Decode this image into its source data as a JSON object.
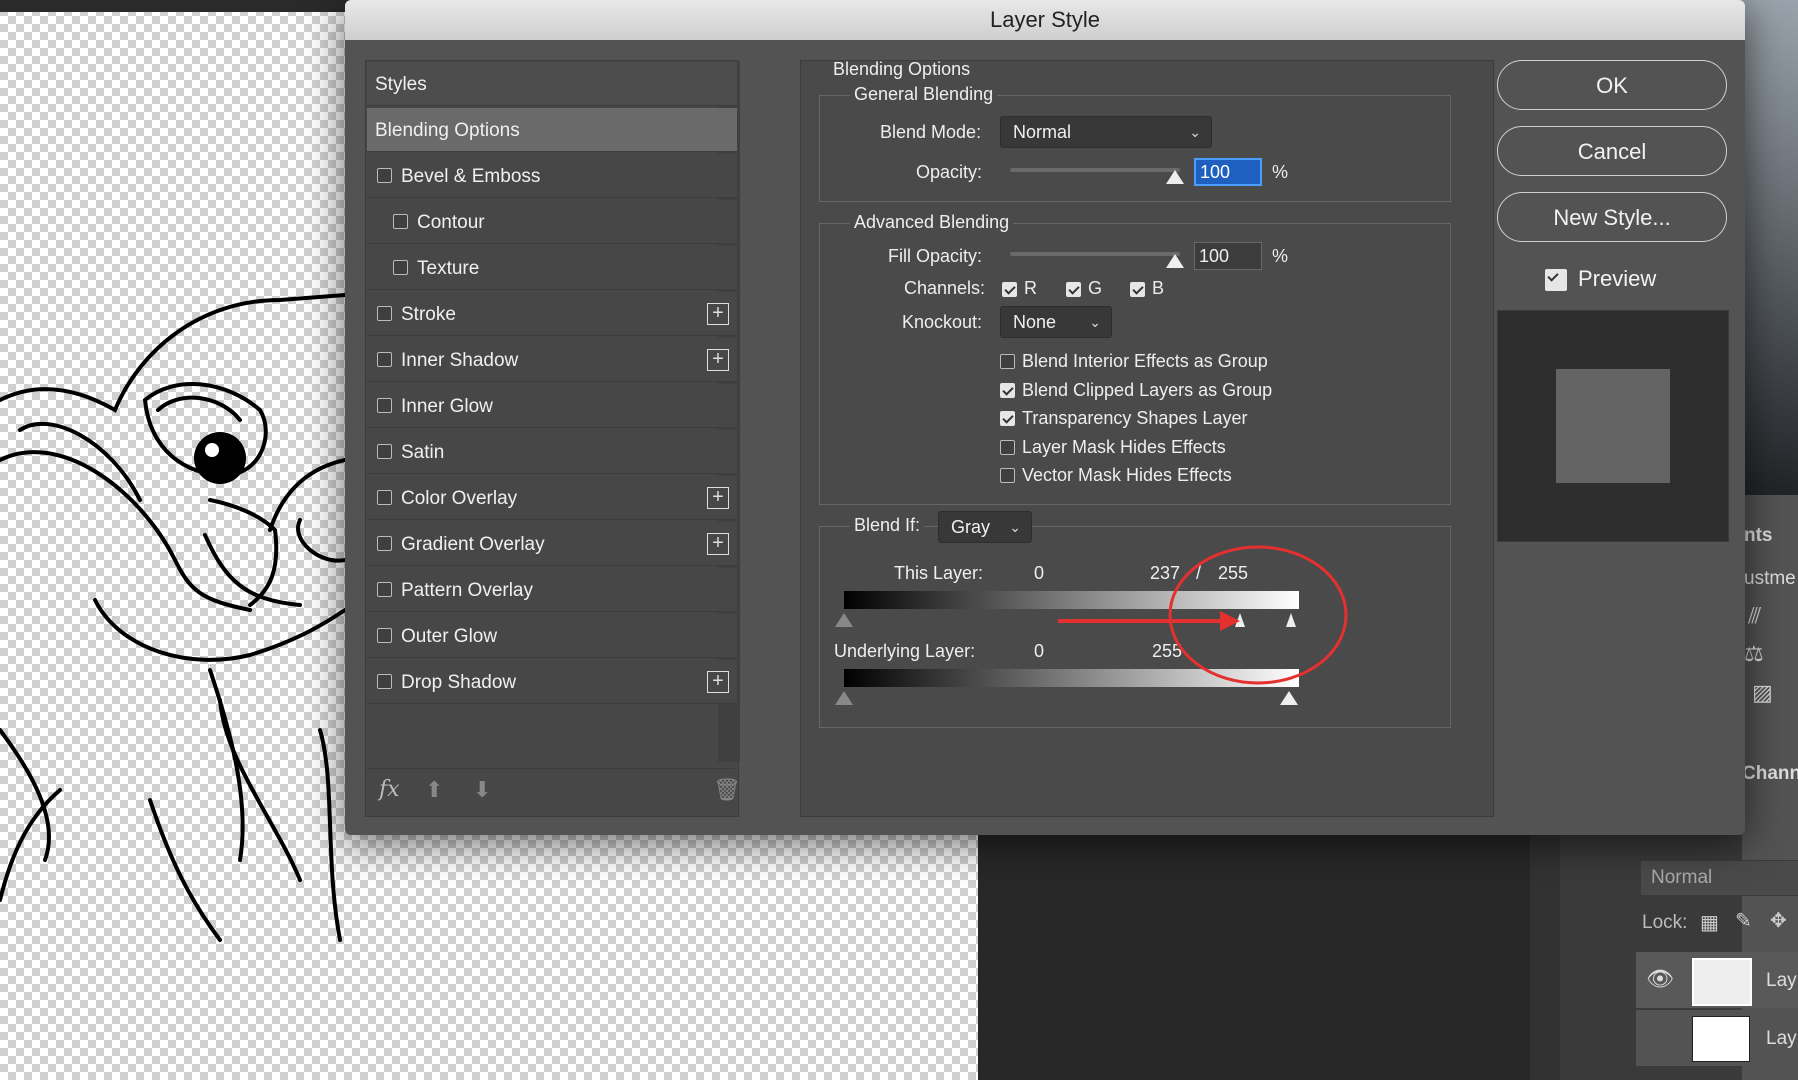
{
  "dialog": {
    "title": "Layer Style"
  },
  "styles": {
    "header": "Styles",
    "items": [
      {
        "label": "Blending Options",
        "checked": null,
        "plus": false
      },
      {
        "label": "Bevel & Emboss",
        "checked": false,
        "plus": false
      },
      {
        "label": "Contour",
        "checked": false,
        "plus": false
      },
      {
        "label": "Texture",
        "checked": false,
        "plus": false
      },
      {
        "label": "Stroke",
        "checked": false,
        "plus": true
      },
      {
        "label": "Inner Shadow",
        "checked": false,
        "plus": true
      },
      {
        "label": "Inner Glow",
        "checked": false,
        "plus": false
      },
      {
        "label": "Satin",
        "checked": false,
        "plus": false
      },
      {
        "label": "Color Overlay",
        "checked": false,
        "plus": true
      },
      {
        "label": "Gradient Overlay",
        "checked": false,
        "plus": true
      },
      {
        "label": "Pattern Overlay",
        "checked": false,
        "plus": false
      },
      {
        "label": "Outer Glow",
        "checked": false,
        "plus": false
      },
      {
        "label": "Drop Shadow",
        "checked": false,
        "plus": true
      }
    ],
    "fx_label": "fx"
  },
  "blending": {
    "title": "Blending Options",
    "general": {
      "title": "General Blending",
      "blend_mode_label": "Blend Mode:",
      "blend_mode": "Normal",
      "opacity_label": "Opacity:",
      "opacity": "100",
      "percent": "%"
    },
    "advanced": {
      "title": "Advanced Blending",
      "fill_opacity_label": "Fill Opacity:",
      "fill_opacity": "100",
      "percent": "%",
      "channels_label": "Channels:",
      "channels": [
        {
          "label": "R",
          "checked": true
        },
        {
          "label": "G",
          "checked": true
        },
        {
          "label": "B",
          "checked": true
        }
      ],
      "knockout_label": "Knockout:",
      "knockout": "None",
      "options": [
        {
          "label": "Blend Interior Effects as Group",
          "checked": false
        },
        {
          "label": "Blend Clipped Layers as Group",
          "checked": true
        },
        {
          "label": "Transparency Shapes Layer",
          "checked": true
        },
        {
          "label": "Layer Mask Hides Effects",
          "checked": false
        },
        {
          "label": "Vector Mask Hides Effects",
          "checked": false
        }
      ]
    },
    "blend_if": {
      "label": "Blend If:",
      "value": "Gray",
      "this_layer_label": "This Layer:",
      "this_layer_min": "0",
      "this_layer_split_low": "237",
      "slash": "/",
      "this_layer_max": "255",
      "underlying_label": "Underlying Layer:",
      "underlying_min": "0",
      "underlying_max": "255"
    }
  },
  "buttons": {
    "ok": "OK",
    "cancel": "Cancel",
    "new_style": "New Style...",
    "preview_label": "Preview",
    "preview_checked": true
  },
  "layers_panel": {
    "tab_partial": "nts",
    "adjust_partial": "ustme",
    "channels_partial": "Chann",
    "blend_mode": "Normal",
    "lock_label": "Lock:",
    "layer1": "Lay",
    "layer2": "Lay"
  }
}
